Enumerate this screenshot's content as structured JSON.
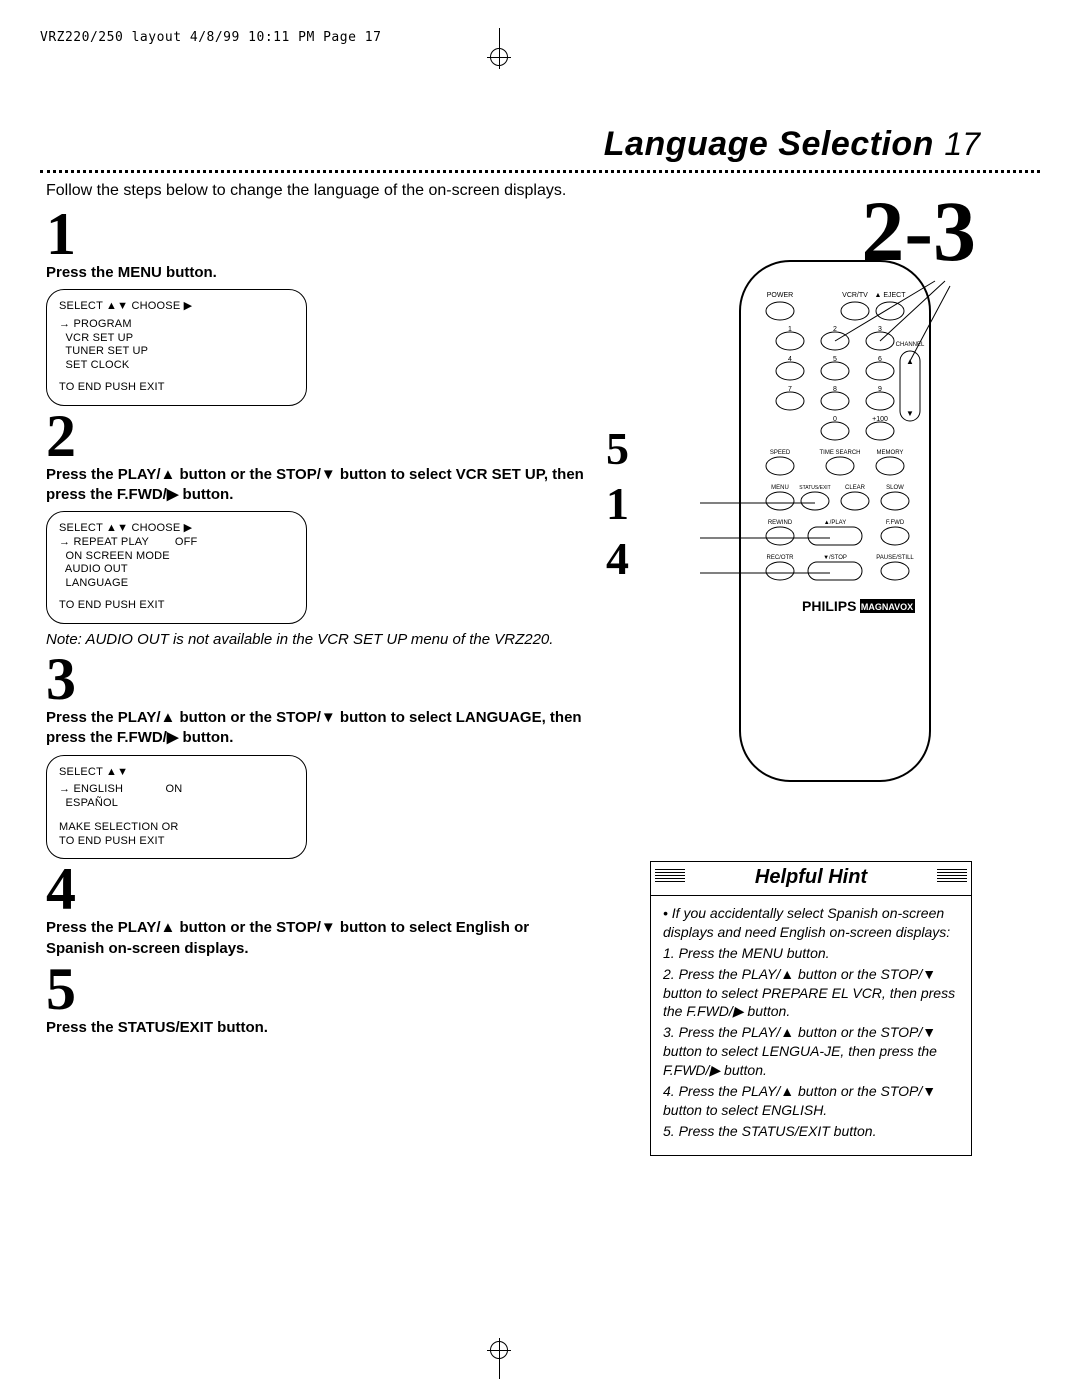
{
  "header_mark": "VRZ220/250 layout  4/8/99 10:11 PM  Page 17",
  "title": "Language Selection",
  "page_number": "17",
  "intro": "Follow the steps below to change the language of the on-screen displays.",
  "big_label": "2-3",
  "callouts": [
    "5",
    "1",
    "4"
  ],
  "steps": [
    {
      "num": "1",
      "text": "Press the MENU button."
    },
    {
      "num": "2",
      "text": "Press the PLAY/▲ button or the STOP/▼ button to select VCR SET UP, then press the F.FWD/▶ button."
    },
    {
      "num": "3",
      "text": "Press the PLAY/▲ button or the STOP/▼ button to select LANGUAGE, then press the F.FWD/▶ button."
    },
    {
      "num": "4",
      "text": "Press the PLAY/▲ button or the STOP/▼ button to select English or Spanish on-screen displays."
    },
    {
      "num": "5",
      "text": "Press the STATUS/EXIT button."
    }
  ],
  "osd1": {
    "header": "SELECT ▲▼ CHOOSE ▶",
    "lines": [
      "→ PROGRAM",
      "  VCR SET UP",
      "  TUNER SET UP",
      "  SET CLOCK"
    ],
    "footer": "TO END PUSH EXIT"
  },
  "osd2": {
    "header": "SELECT ▲▼ CHOOSE ▶",
    "lines": [
      "→ REPEAT PLAY        OFF",
      "  ON SCREEN MODE",
      "  AUDIO OUT",
      "  LANGUAGE"
    ],
    "footer": "TO END PUSH EXIT"
  },
  "note2": "Note: AUDIO OUT is not available in the VCR SET UP menu of the VRZ220.",
  "osd3": {
    "header": "SELECT ▲▼",
    "lines": [
      "→ ENGLISH             ON",
      "  ESPAÑOL"
    ],
    "footer1": "MAKE SELECTION OR",
    "footer2": "TO END PUSH EXIT"
  },
  "hint": {
    "title": "Helpful Hint",
    "bullet": "If you accidentally select Spanish on-screen displays and need English on-screen displays:",
    "items": [
      "Press the MENU button.",
      "Press the PLAY/▲ button or the STOP/▼ button to select PREPARE EL VCR, then press the F.FWD/▶ button.",
      "Press the PLAY/▲ button or the STOP/▼ button to select LENGUA-JE, then press the F.FWD/▶ button.",
      "Press the PLAY/▲ button or the STOP/▼ button to select ENGLISH.",
      "Press the STATUS/EXIT button."
    ]
  },
  "remote": {
    "top_labels": [
      "POWER",
      "VCR/TV",
      "",
      "EJECT"
    ],
    "row_labels": [
      "SPEED",
      "TIME SEARCH",
      "MEMORY",
      "MENU",
      "STATUS/EXIT",
      "CLEAR",
      "SLOW",
      "REWIND",
      "▲/PLAY",
      "F.FWD",
      "REC/OTR",
      "▼/STOP",
      "PAUSE/STILL",
      "CHANNEL"
    ],
    "brand": "PHILIPS",
    "brand2": "MAGNAVOX",
    "keypad": [
      "1",
      "2",
      "3",
      "4",
      "5",
      "6",
      "7",
      "8",
      "9",
      "0",
      "+100"
    ]
  }
}
